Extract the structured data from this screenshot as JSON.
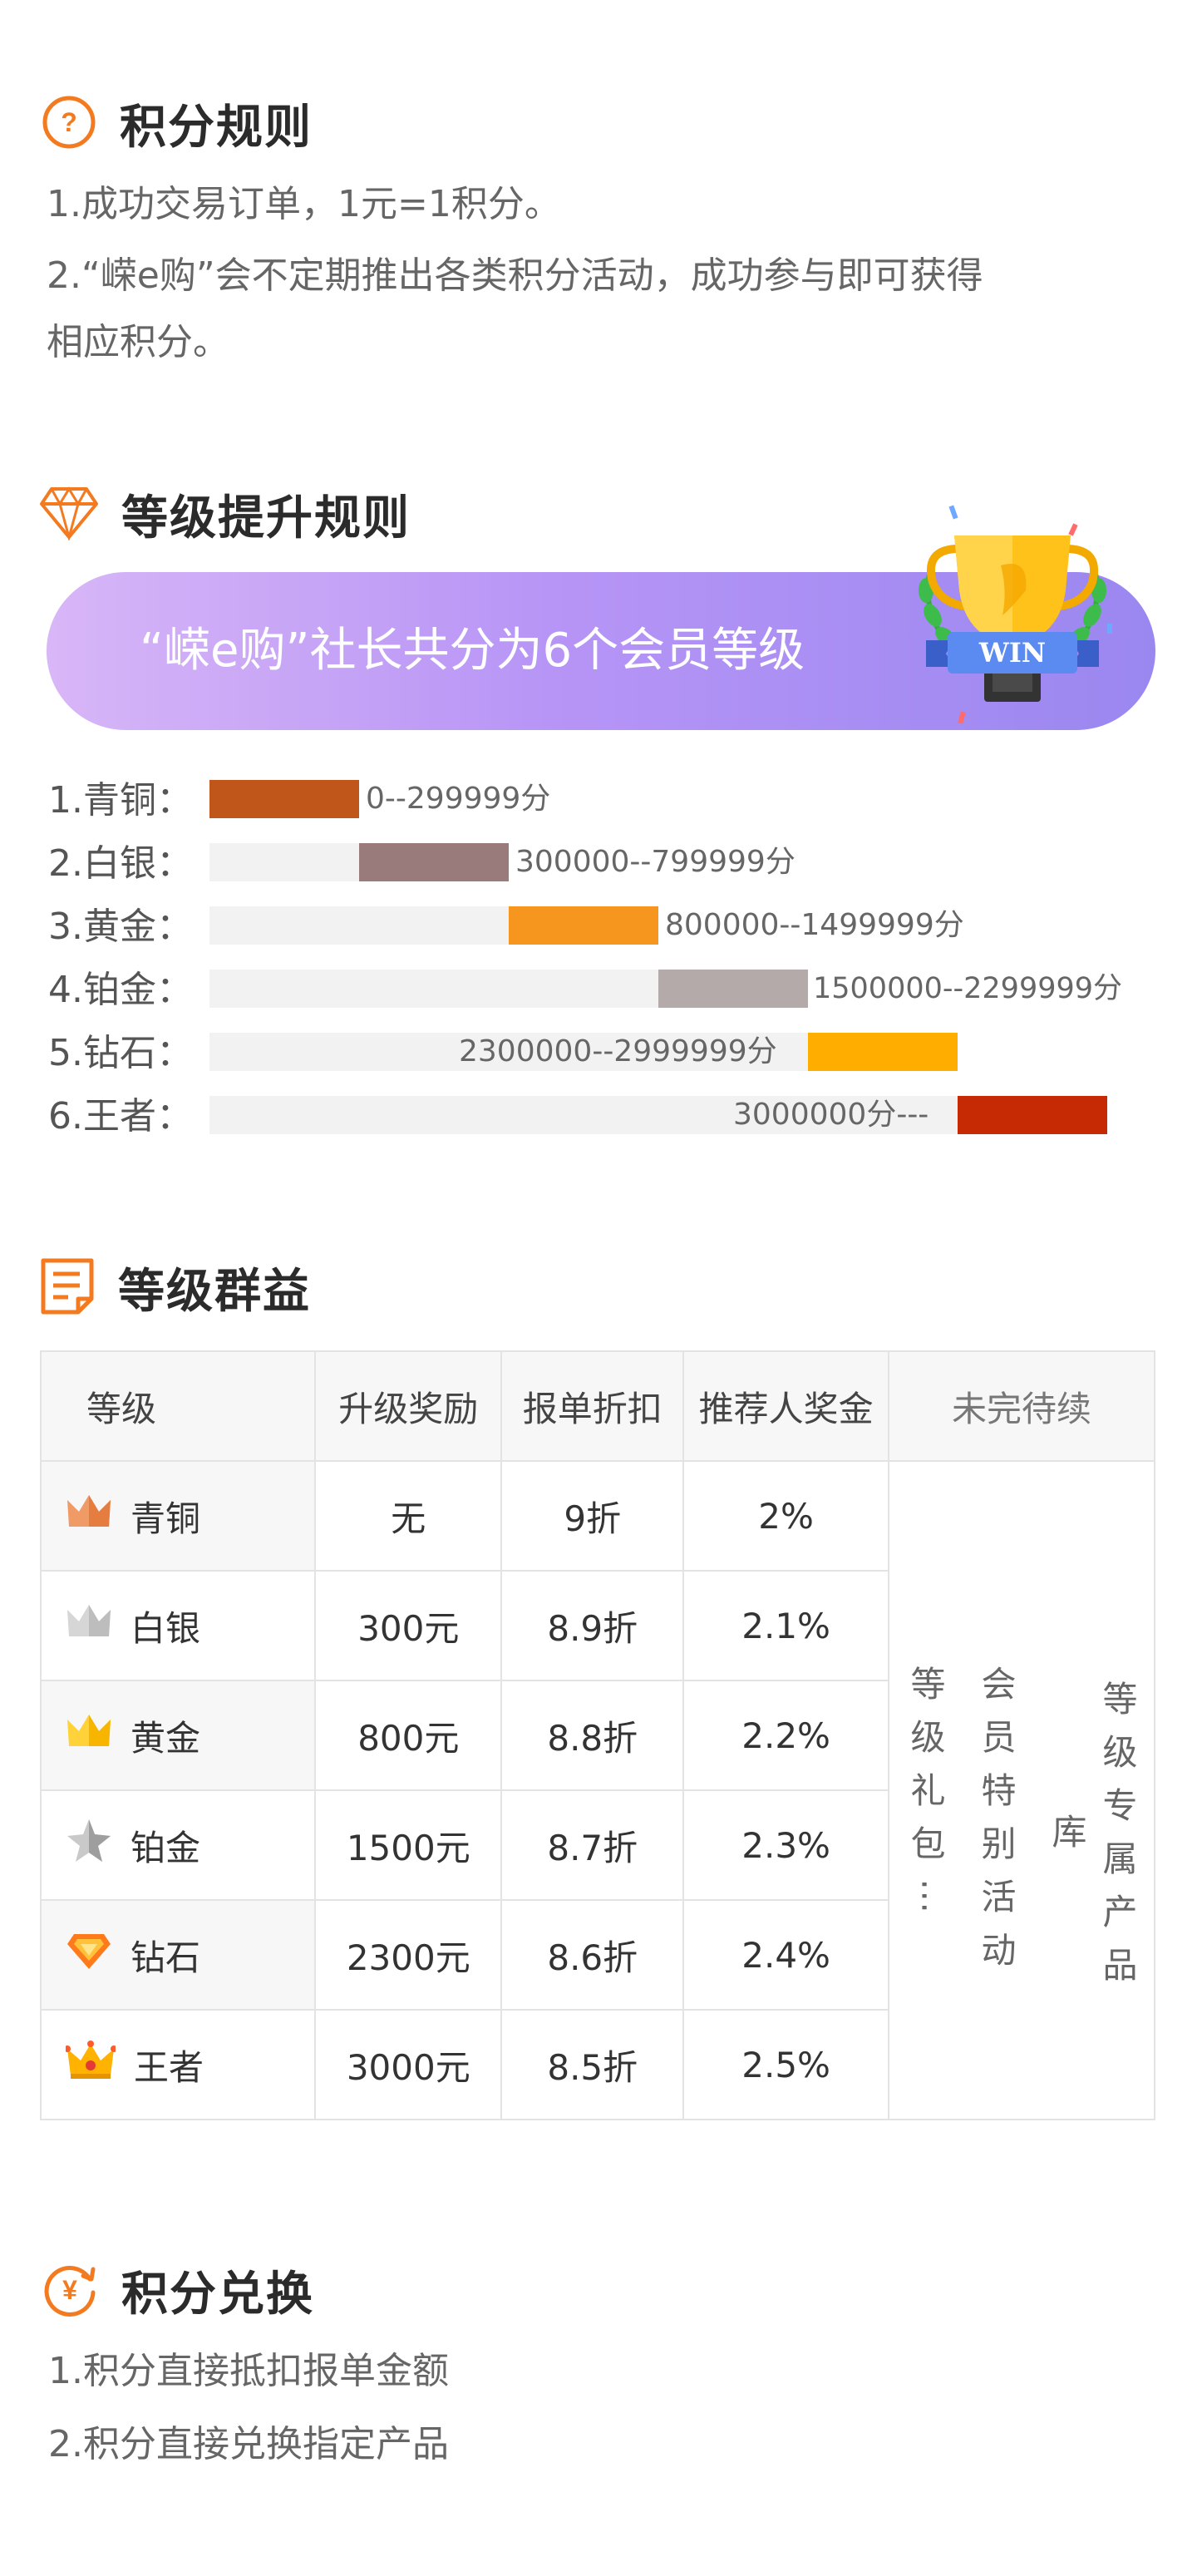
{
  "points_rules": {
    "title": "积分规则",
    "lines": [
      "1.成功交易订单，1元=1积分。",
      "2.“嵘e购”会不定期推出各类积分活动，成功参与即可获得",
      "相应积分。"
    ]
  },
  "level_up_rules": {
    "title": "等级提升规则",
    "banner_text": "“嵘e购”社长共分为6个会员等级",
    "trophy_text": "WIN",
    "levels": [
      {
        "label": "1.青铜：",
        "range": "0--299999分",
        "color": "#c0561a"
      },
      {
        "label": "2.白银：",
        "range": "300000--799999分",
        "color": "#9a7b7b"
      },
      {
        "label": "3.黄金：",
        "range": "800000--1499999分",
        "color": "#f7961e"
      },
      {
        "label": "4.铂金：",
        "range": "1500000--2299999分",
        "color": "#b4aaaa"
      },
      {
        "label": "5.钻石：",
        "range": "2300000--2999999分",
        "color": "#ffae00"
      },
      {
        "label": "6.王者：",
        "range": "3000000分---",
        "color": "#c52a05"
      }
    ]
  },
  "benefits": {
    "title": "等级群益",
    "headers": [
      "等级",
      "升级奖励",
      "报单折扣",
      "推荐人奖金",
      "未完待续"
    ],
    "rows": [
      {
        "level": "青铜",
        "icon": "bronze-crown-icon",
        "reward": "无",
        "discount": "9折",
        "bonus": "2%"
      },
      {
        "level": "白银",
        "icon": "silver-crown-icon",
        "reward": "300元",
        "discount": "8.9折",
        "bonus": "2.1%"
      },
      {
        "level": "黄金",
        "icon": "gold-crown-icon",
        "reward": "800元",
        "discount": "8.8折",
        "bonus": "2.2%"
      },
      {
        "level": "铂金",
        "icon": "platinum-star-icon",
        "reward": "1500元",
        "discount": "8.7折",
        "bonus": "2.3%"
      },
      {
        "level": "钻石",
        "icon": "diamond-icon",
        "reward": "2300元",
        "discount": "8.6折",
        "bonus": "2.4%"
      },
      {
        "level": "王者",
        "icon": "king-crown-icon",
        "reward": "3000元",
        "discount": "8.5折",
        "bonus": "2.5%"
      }
    ],
    "tbc_columns": [
      "等级礼包⋯",
      "会员特别活动",
      "等级专属产品库"
    ]
  },
  "points_exchange": {
    "title": "积分兑换",
    "lines": [
      "1.积分直接抵扣报单金额",
      "2.积分直接兑换指定产品"
    ]
  },
  "colors": {
    "accent": "#f47a20",
    "banner_start": "#d8b6f7",
    "banner_end": "#9a87f0"
  }
}
